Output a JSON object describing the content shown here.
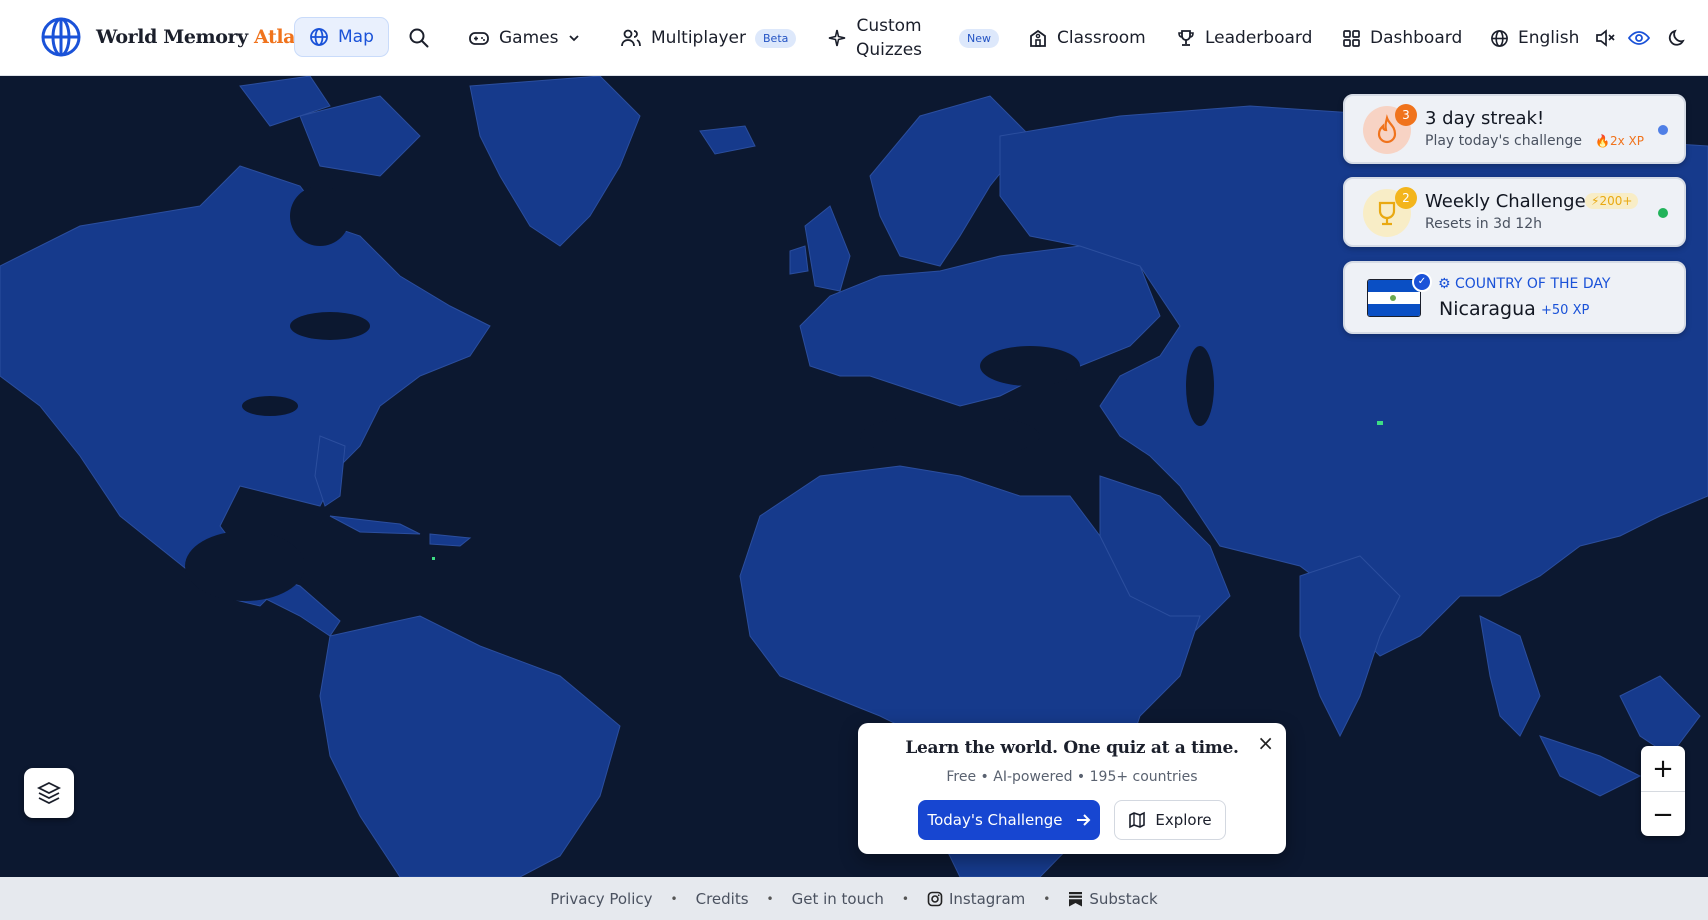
{
  "nav": {
    "brand_main": "World Memory ",
    "brand_accent": "Atlas",
    "map_label": "Map",
    "games_label": "Games",
    "multiplayer_label": "Multiplayer",
    "multiplayer_badge": "Beta",
    "custom_line1": "Custom",
    "custom_line2": "Quizzes",
    "custom_badge": "New",
    "classroom_label": "Classroom",
    "leaderboard_label": "Leaderboard",
    "dashboard_label": "Dashboard",
    "language_label": "English",
    "icons": [
      "globe-logo-icon",
      "globe-icon",
      "search-icon",
      "gamepad-icon",
      "chevron-down-icon",
      "users-icon",
      "sparkles-icon",
      "school-icon",
      "trophy-icon",
      "grid-icon",
      "globe-language-icon",
      "mute-icon",
      "eye-icon",
      "moon-icon"
    ]
  },
  "cards": {
    "streak": {
      "count": "3",
      "title": "3 day streak!",
      "sub": "Play today's challenge",
      "bonus": "2x XP",
      "dot_color": "#4f7fe6"
    },
    "weekly": {
      "count": "2",
      "title": "Weekly Challenge",
      "sub": "Resets in 3d 12h",
      "bonus": "200+",
      "dot_color": "#21b35a"
    },
    "country": {
      "kicker": "COUNTRY OF THE DAY",
      "name": "Nicaragua",
      "xp": "+50 XP"
    }
  },
  "popup": {
    "title": "Learn the world. One quiz at a time.",
    "subtitle": "Free • AI-powered • 195+ countries",
    "primary_label": "Today's Challenge",
    "secondary_label": "Explore",
    "close_label": "×"
  },
  "map": {
    "zoom_in": "+",
    "zoom_out": "−",
    "ocean_color": "#0c1830",
    "land_color": "#163a8c"
  },
  "footer": {
    "links": [
      "Privacy Policy",
      "Credits",
      "Get in touch",
      "Instagram",
      "Substack"
    ],
    "separator": "•"
  }
}
